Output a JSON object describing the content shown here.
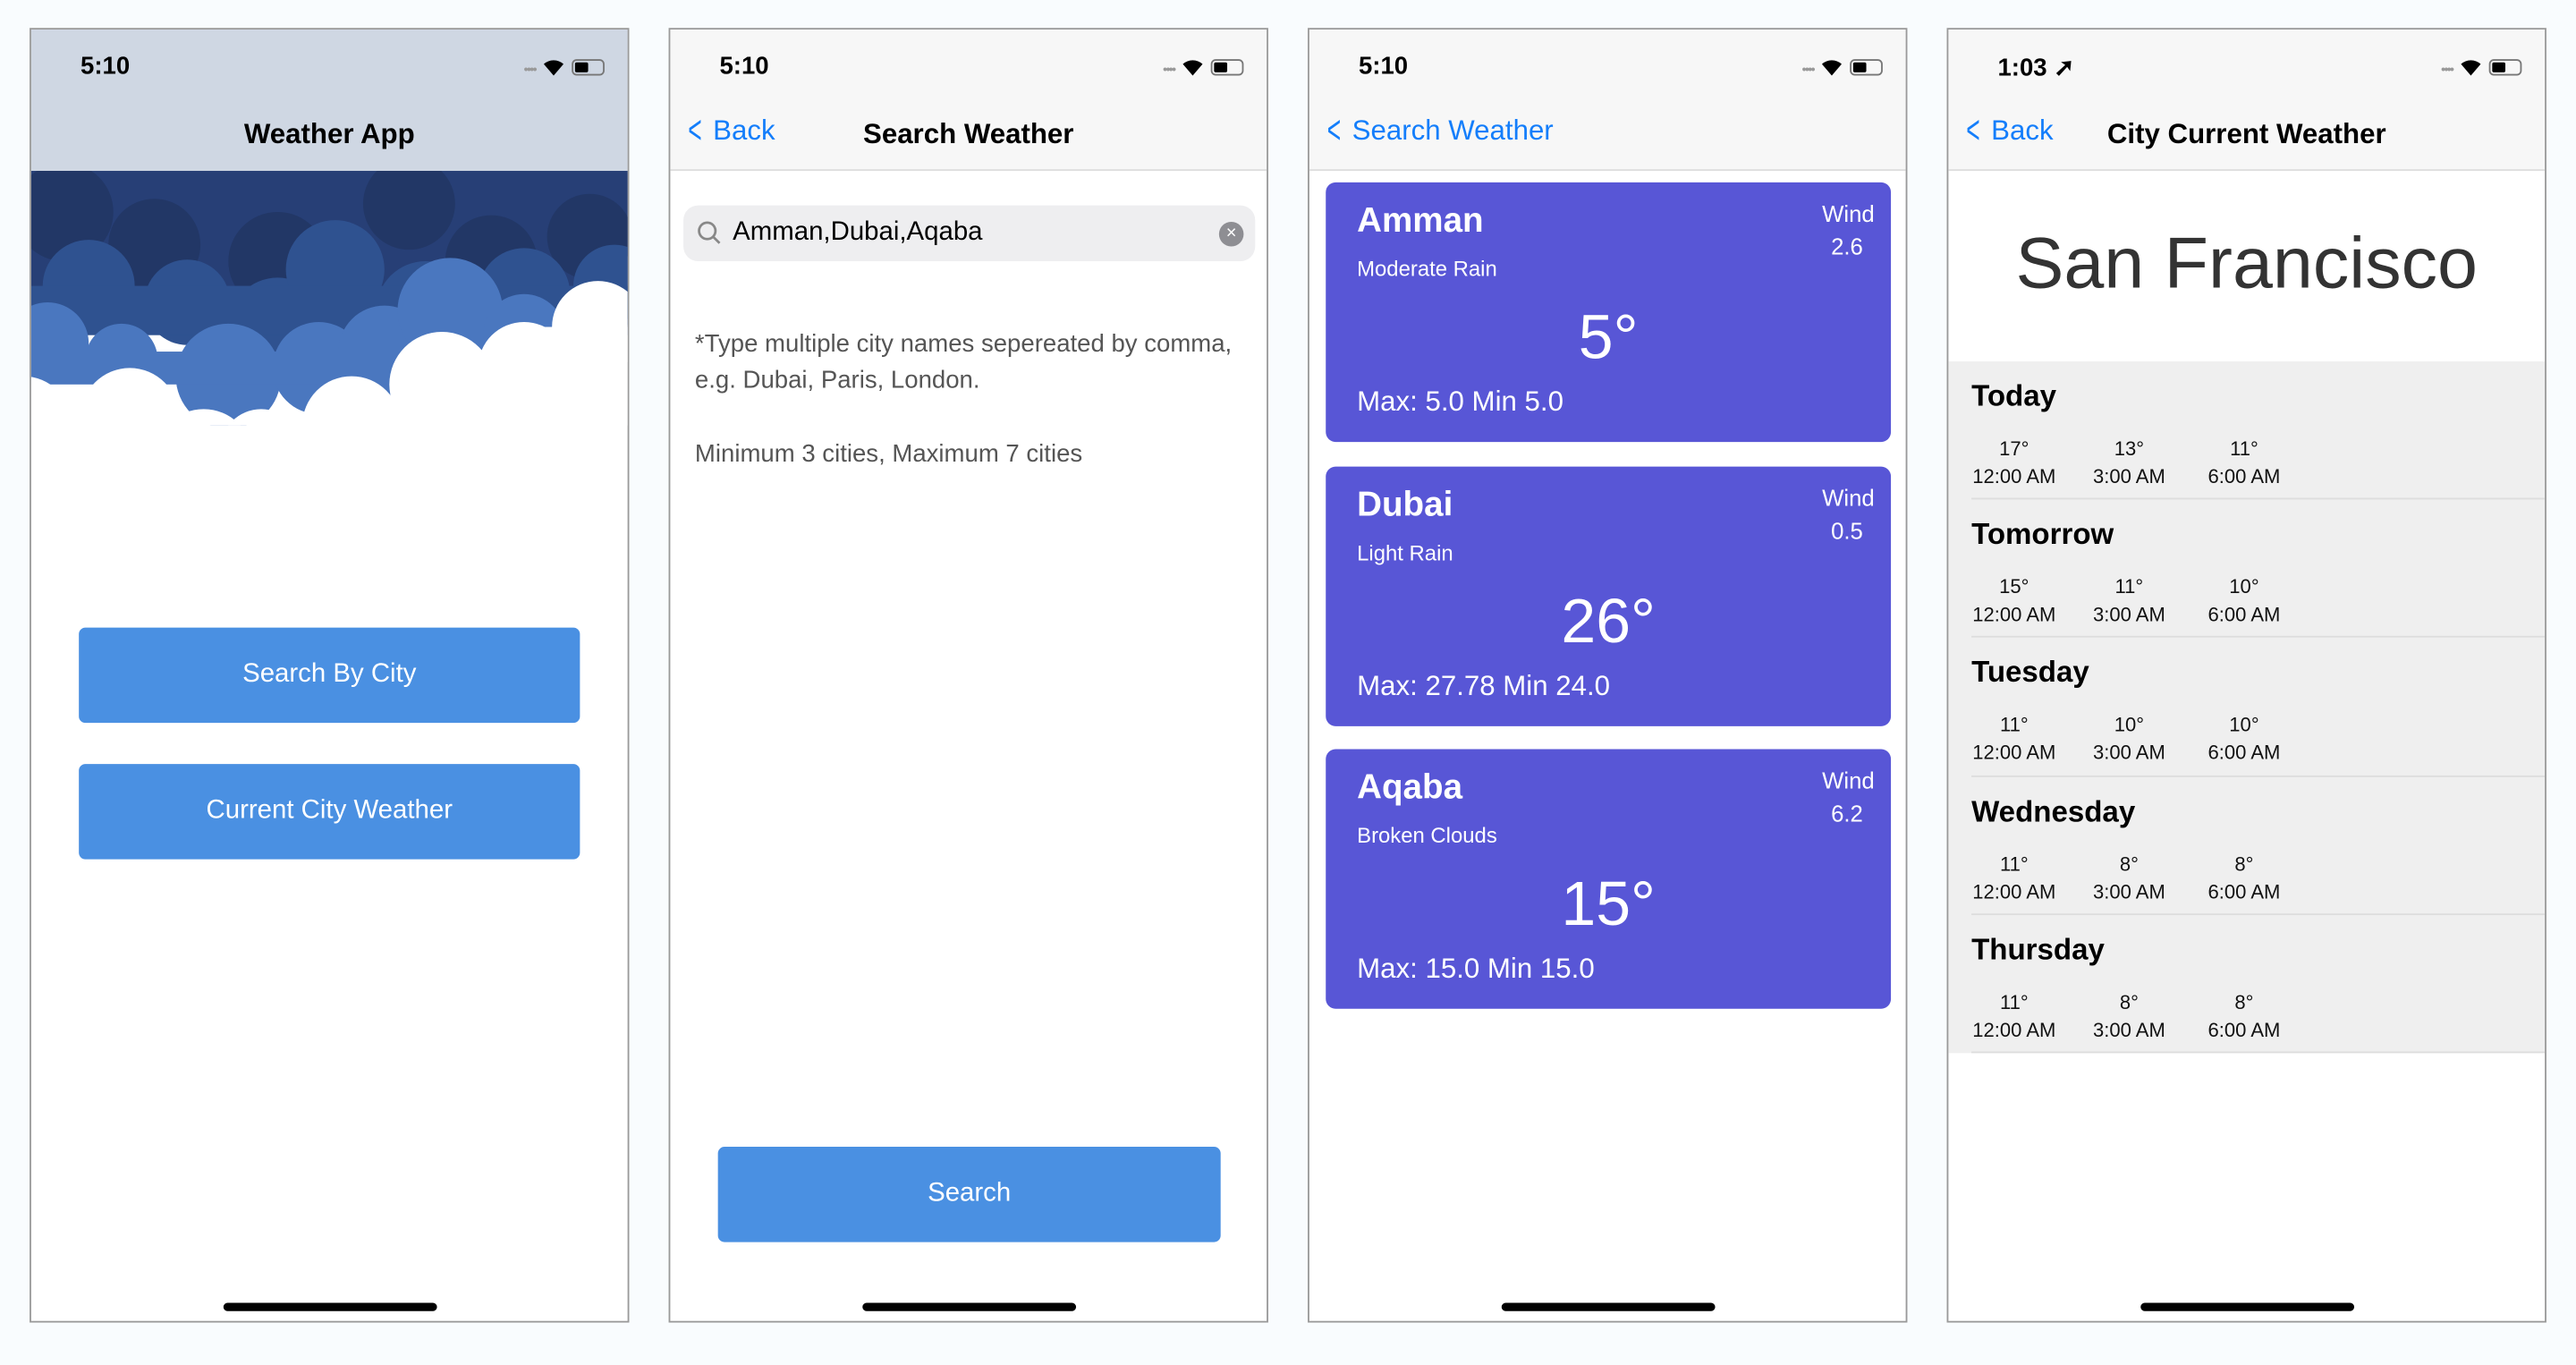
{
  "colors": {
    "button": "#4a90e2",
    "card": "#5856d6",
    "link": "#147efb",
    "home_header": "#cfd7e3"
  },
  "screens": [
    {
      "status_time": "5:10",
      "title": "Weather App",
      "buttons": [
        "Search By City",
        "Current City Weather"
      ]
    },
    {
      "status_time": "5:10",
      "back_label": "Back",
      "title": "Search Weather",
      "search": {
        "value": "Amman,Dubai,Aqaba",
        "icon": "search-icon",
        "clear_icon": "clear-icon"
      },
      "hint": "*Type multiple city names sepereated by comma, e.g. Dubai, Paris, London.",
      "limits": "Minimum 3 cities, Maximum 7 cities",
      "search_button": "Search"
    },
    {
      "status_time": "5:10",
      "back_label": "Search Weather",
      "cards": [
        {
          "city": "Amman",
          "condition": "Moderate Rain",
          "wind_label": "Wind",
          "wind": "2.6",
          "temp": "5°",
          "minmax": "Max: 5.0 Min 5.0"
        },
        {
          "city": "Dubai",
          "condition": "Light Rain",
          "wind_label": "Wind",
          "wind": "0.5",
          "temp": "26°",
          "minmax": "Max: 27.78 Min 24.0"
        },
        {
          "city": "Aqaba",
          "condition": "Broken Clouds",
          "wind_label": "Wind",
          "wind": "6.2",
          "temp": "15°",
          "minmax": "Max: 15.0 Min 15.0"
        }
      ]
    },
    {
      "status_time": "1:03",
      "back_label": "Back",
      "title": "City Current Weather",
      "city": "San Francisco",
      "forecast": [
        {
          "day": "Today",
          "slots": [
            {
              "t": "17°",
              "h": "12:00 AM"
            },
            {
              "t": "13°",
              "h": "3:00 AM"
            },
            {
              "t": "11°",
              "h": "6:00 AM"
            }
          ]
        },
        {
          "day": "Tomorrow",
          "slots": [
            {
              "t": "15°",
              "h": "12:00 AM"
            },
            {
              "t": "11°",
              "h": "3:00 AM"
            },
            {
              "t": "10°",
              "h": "6:00 AM"
            }
          ]
        },
        {
          "day": "Tuesday",
          "slots": [
            {
              "t": "11°",
              "h": "12:00 AM"
            },
            {
              "t": "10°",
              "h": "3:00 AM"
            },
            {
              "t": "10°",
              "h": "6:00 AM"
            }
          ]
        },
        {
          "day": "Wednesday",
          "slots": [
            {
              "t": "11°",
              "h": "12:00 AM"
            },
            {
              "t": "8°",
              "h": "3:00 AM"
            },
            {
              "t": "8°",
              "h": "6:00 AM"
            }
          ]
        },
        {
          "day": "Thursday",
          "slots": [
            {
              "t": "11°",
              "h": "12:00 AM"
            },
            {
              "t": "8°",
              "h": "3:00 AM"
            },
            {
              "t": "8°",
              "h": "6:00 AM"
            }
          ]
        }
      ]
    }
  ]
}
